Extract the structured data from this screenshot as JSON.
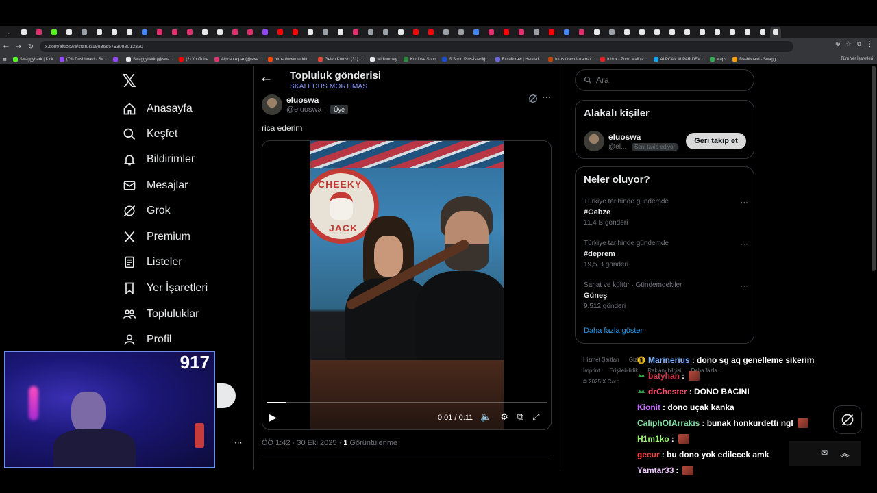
{
  "browser": {
    "url": "x.com/eluoswa/status/1983665793088012320",
    "bookmarks": [
      {
        "label": "Swaggybark | Kick",
        "color": "#53fc18"
      },
      {
        "label": "(79) Dashboard / Str...",
        "color": "#9146ff"
      },
      {
        "label": "",
        "color": "#9146ff"
      },
      {
        "label": "Swaggybark (@swa...",
        "color": "#e7e9ea"
      },
      {
        "label": "(2) YouTube",
        "color": "#ff0000"
      },
      {
        "label": "Alpcan Alpar (@swa...",
        "color": "#e1306c"
      },
      {
        "label": "https://www.reddit....",
        "color": "#ff4500"
      },
      {
        "label": "Gelen Kutusu (31) -...",
        "color": "#ea4335"
      },
      {
        "label": "Midjourney",
        "color": "#e7e9ea"
      },
      {
        "label": "Konfuse Shop",
        "color": "#2b8a3e"
      },
      {
        "label": "S Sport Plus-İstediğ...",
        "color": "#1d4ed8"
      },
      {
        "label": "Excalidraw | Hand-d...",
        "color": "#6965db"
      },
      {
        "label": "https://next.inkamat...",
        "color": "#c2410c"
      },
      {
        "label": "Inbox - Zoho Mail (a...",
        "color": "#e42527"
      },
      {
        "label": "ALPCAN ALPAR DEV...",
        "color": "#0ea5e9"
      },
      {
        "label": "Maps",
        "color": "#34a853"
      },
      {
        "label": "Dashboard - Swagg...",
        "color": "#f59e0b"
      }
    ],
    "bookmarks_all": "Tüm Yer İşaretleri",
    "tab_colors": [
      "#e7e9ea",
      "#e1306c",
      "#53fc18",
      "#e7e9ea",
      "#9aa0a6",
      "#e7e9ea",
      "#e7e9ea",
      "#e7e9ea",
      "#4285f4",
      "#e1306c",
      "#e1306c",
      "#e1306c",
      "#e7e9ea",
      "#e7e9ea",
      "#e1306c",
      "#e1306c",
      "#9146ff",
      "#ff0000",
      "#ff0000",
      "#e7e9ea",
      "#9aa0a6",
      "#e7e9ea",
      "#e1306c",
      "#9aa0a6",
      "#9aa0a6",
      "#e7e9ea",
      "#ff0000",
      "#ff0000",
      "#9aa0a6",
      "#9aa0a6",
      "#4285f4",
      "#e1306c",
      "#ff0000",
      "#e1306c",
      "#9aa0a6",
      "#ff0000",
      "#4285f4",
      "#e1306c",
      "#e7e9ea",
      "#9aa0a6",
      "#e7e9ea",
      "#e7e9ea",
      "#e7e9ea",
      "#e7e9ea",
      "#e7e9ea",
      "#e7e9ea",
      "#e7e9ea",
      "#e7e9ea",
      "#e7e9ea",
      "#e7e9ea",
      "#e7e9ea"
    ]
  },
  "nav": {
    "items": [
      {
        "label": "Anasayfa",
        "icon": "home-icon"
      },
      {
        "label": "Keşfet",
        "icon": "search-icon"
      },
      {
        "label": "Bildirimler",
        "icon": "bell-icon"
      },
      {
        "label": "Mesajlar",
        "icon": "mail-icon"
      },
      {
        "label": "Grok",
        "icon": "grok-icon"
      },
      {
        "label": "Premium",
        "icon": "x-logo-icon"
      },
      {
        "label": "Listeler",
        "icon": "list-icon"
      },
      {
        "label": "Yer İşaretleri",
        "icon": "bookmark-icon"
      },
      {
        "label": "Topluluklar",
        "icon": "communities-icon"
      },
      {
        "label": "Profil",
        "icon": "profile-icon"
      }
    ]
  },
  "post": {
    "header_title": "Topluluk gönderisi",
    "header_subtitle": "SKALEDUS MORTIMAS",
    "author_name": "eluoswa",
    "author_handle": "@eluoswa ·",
    "author_badge": "Üye",
    "text": "rica ederim",
    "video": {
      "time": "0:01 / 0:11",
      "progress": 0.07,
      "sign_top": "CHEEKY",
      "sign_bottom": "JACK"
    },
    "meta_time": "ÖÖ 1:42 · 30 Eki 2025 ·",
    "meta_views_count": "1",
    "meta_views_label": "Görüntülenme"
  },
  "right": {
    "search_placeholder": "Ara",
    "related_title": "Alakalı kişiler",
    "related_name": "eluoswa",
    "related_handle": "@el...",
    "related_badge": "Seni takip ediyor",
    "follow_label": "Geri takip et",
    "trends_title": "Neler oluyor?",
    "trends": [
      {
        "context": "Türkiye tarihinde gündemde",
        "name": "#Gebze",
        "count": "11,4 B gönderi"
      },
      {
        "context": "Türkiye tarihinde gündemde",
        "name": "#deprem",
        "count": "19,5 B gönderi"
      },
      {
        "context": "Sanat ve kültür · Gündemdekiler",
        "name": "Güneş",
        "count": "9.512 gönderi"
      }
    ],
    "show_more": "Daha fazla göster",
    "footer": [
      "Hizmet Şartları",
      "Gizlilik",
      "Imprint",
      "Erişilebilirlik",
      "Reklam bilgisi",
      "Daha fazla ...",
      "© 2025 X Corp."
    ]
  },
  "stream": {
    "viewer_count": "917",
    "chat": [
      {
        "user": "Marinerius",
        "color": "#7fb2ff",
        "msg": ": dono sg aq genelleme sikerim",
        "badge": "gold",
        "emote": false
      },
      {
        "user": "batyhan",
        "color": "#d8334a",
        "msg": ":",
        "badge": "green",
        "emote": true
      },
      {
        "user": "drChester",
        "color": "#ff4d6d",
        "msg": ": DONO BACINI",
        "badge": "green",
        "emote": false
      },
      {
        "user": "Kionit",
        "color": "#c46bff",
        "msg": ": dono uçak kanka",
        "badge": "",
        "emote": false
      },
      {
        "user": "CaliphOfArrakis",
        "color": "#7ee0a0",
        "msg": ": bunak honkurdetti ngl",
        "badge": "",
        "emote": true
      },
      {
        "user": "H1m1ko",
        "color": "#9cf07a",
        "msg": ":",
        "badge": "",
        "emote": true
      },
      {
        "user": "gecur",
        "color": "#ff3b3b",
        "msg": ": bu dono yok edilecek amk",
        "badge": "",
        "emote": false
      },
      {
        "user": "Yamtar33",
        "color": "#f0c8ff",
        "msg": ":",
        "badge": "",
        "emote": true
      }
    ]
  }
}
